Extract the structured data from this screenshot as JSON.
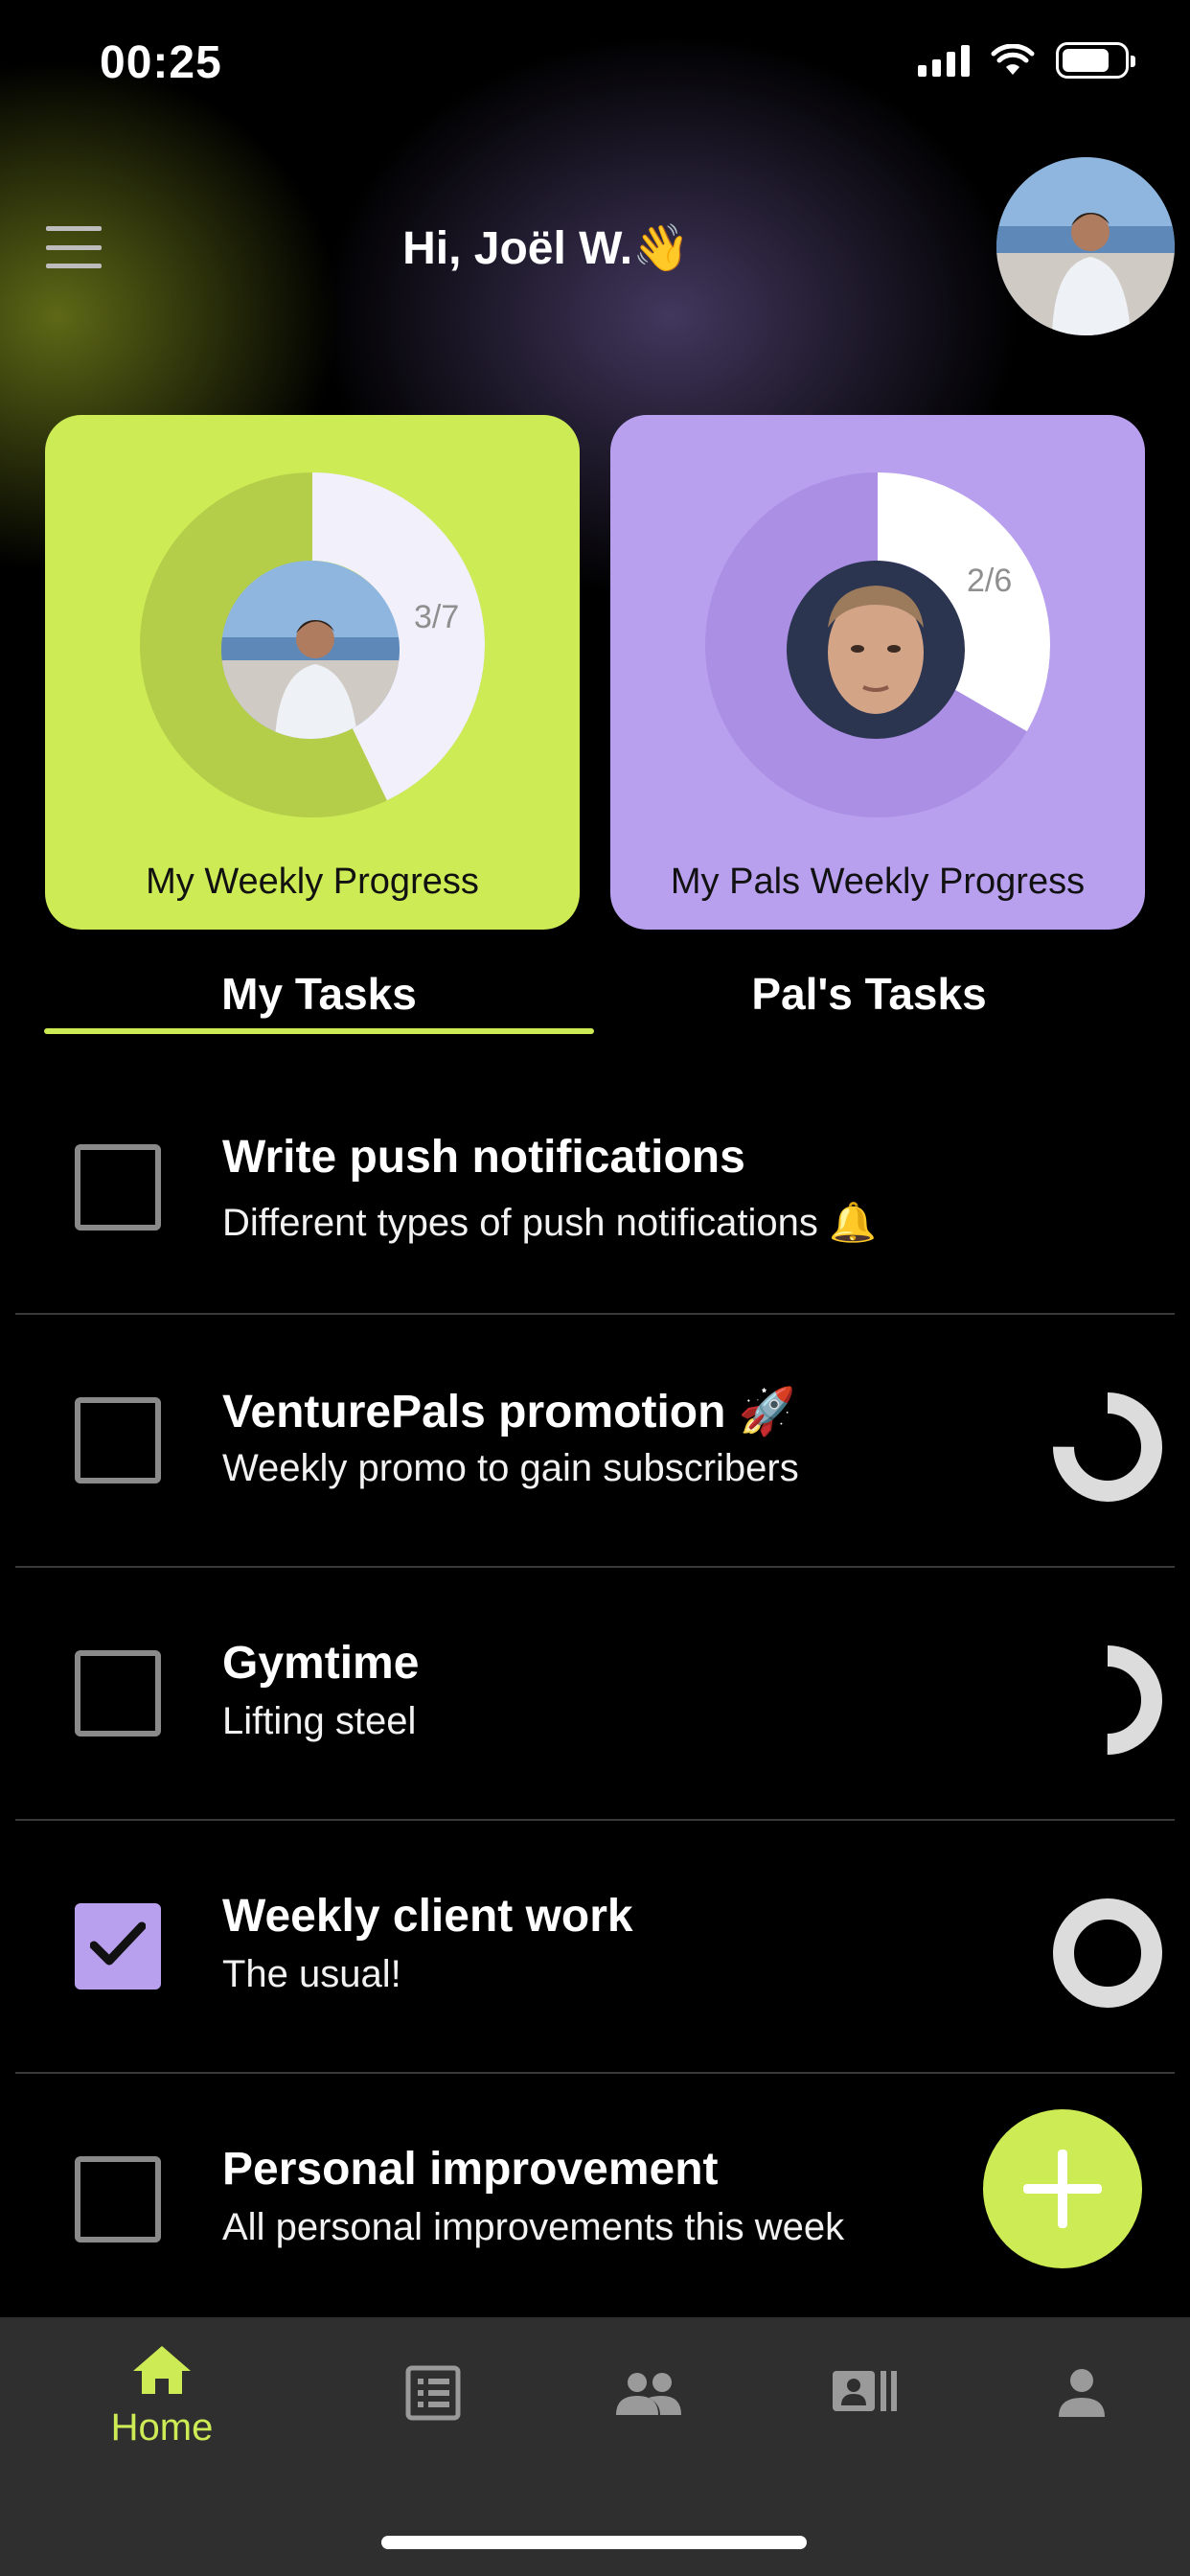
{
  "status_bar": {
    "time": "00:25"
  },
  "header": {
    "greeting": "Hi, Joël W.👋"
  },
  "progress": {
    "mine": {
      "label": "3/7",
      "done": 3,
      "total": 7,
      "title": "My Weekly Progress"
    },
    "pals": {
      "label": "2/6",
      "done": 2,
      "total": 6,
      "title": "My Pals Weekly Progress"
    }
  },
  "tabs": [
    {
      "label": "My Tasks",
      "active": true
    },
    {
      "label": "Pal's Tasks",
      "active": false
    }
  ],
  "tasks": [
    {
      "title": "Write push notifications",
      "subtitle": "Different types of push notifications 🔔",
      "checked": false,
      "progress": null
    },
    {
      "title": "VenturePals promotion 🚀",
      "subtitle": "Weekly promo to gain subscribers",
      "checked": false,
      "progress": 0.75
    },
    {
      "title": "Gymtime",
      "subtitle": "Lifting steel",
      "checked": false,
      "progress": 0.5
    },
    {
      "title": "Weekly client work",
      "subtitle": "The usual!",
      "checked": true,
      "progress": 1.0
    },
    {
      "title": "Personal improvement",
      "subtitle": "All personal improvements this week",
      "checked": false,
      "progress": null
    }
  ],
  "bottom_nav": [
    {
      "label": "Home",
      "icon": "home-icon",
      "active": true
    },
    {
      "label": "",
      "icon": "list-icon",
      "active": false
    },
    {
      "label": "",
      "icon": "group-icon",
      "active": false
    },
    {
      "label": "",
      "icon": "contact-card-icon",
      "active": false
    },
    {
      "label": "",
      "icon": "person-icon",
      "active": false
    }
  ],
  "colors": {
    "accent": "#cdeb55",
    "purple": "#b8a0ef",
    "nav_bg": "#2f2f2f",
    "divider": "#3a3a3a"
  }
}
